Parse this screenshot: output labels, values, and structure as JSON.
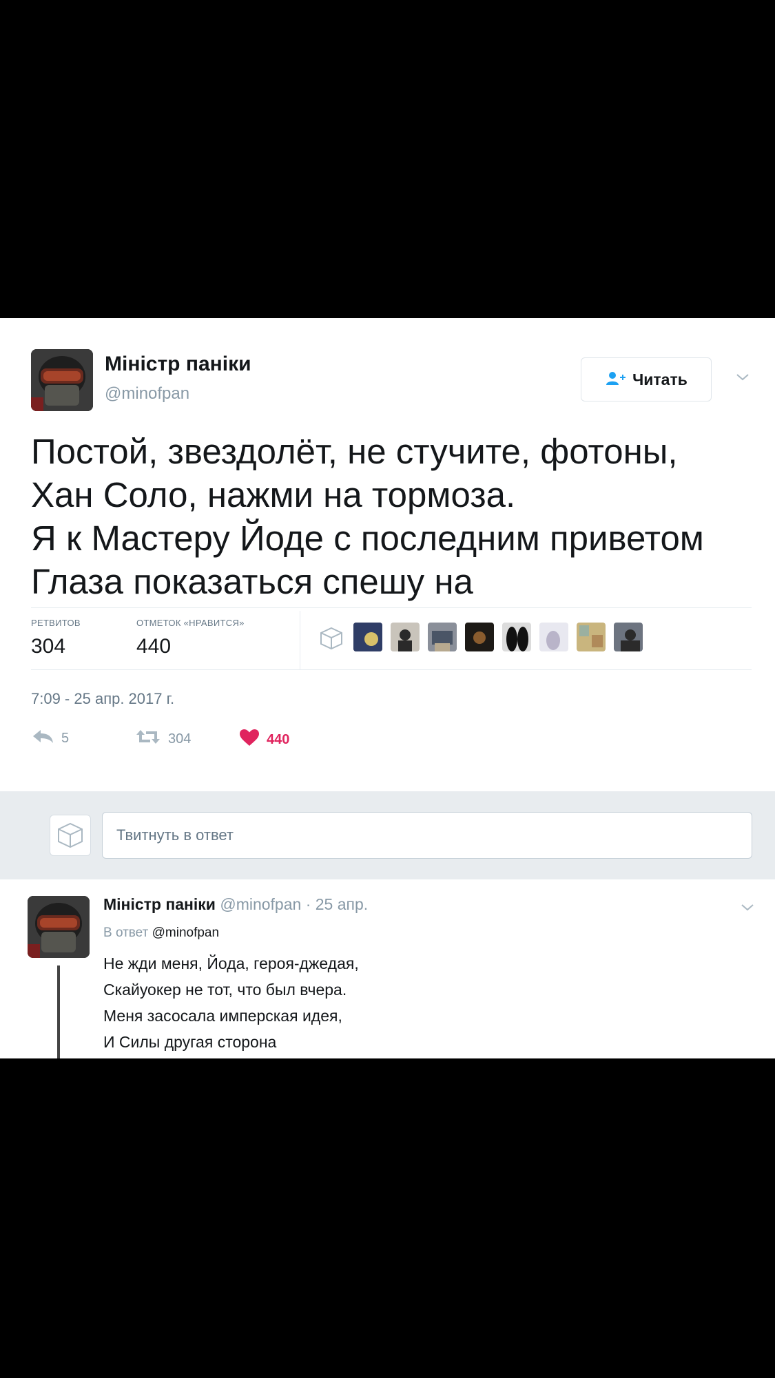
{
  "tweet": {
    "author_name": "Міністр паніки",
    "author_handle": "@minofpan",
    "follow_label": "Читать",
    "text_lines": [
      "Постой, звездолёт, не стучите, фотоны,",
      "Хан Соло, нажми на тормоза.",
      "Я к Мастеру Йоде с последним приветом",
      "Глаза показаться спешу на"
    ],
    "stats": {
      "retweets_label": "РЕТВИТОВ",
      "retweets_value": "304",
      "likes_label": "ОТМЕТОК «НРАВИТСЯ»",
      "likes_value": "440"
    },
    "timestamp": "7:09 - 25 апр. 2017 г.",
    "actions": {
      "reply_count": "5",
      "retweet_count": "304",
      "like_count": "440"
    }
  },
  "reply_composer": {
    "placeholder": "Твитнуть в ответ"
  },
  "reply_tweet": {
    "author_name": "Міністр паніки",
    "author_handle": "@minofpan",
    "separator": "·",
    "date": "25 апр.",
    "in_reply_prefix": "В ответ",
    "in_reply_handle": "@minofpan",
    "text_lines": [
      "Не жди меня, Йода, героя-джедая,",
      "Скайуокер не тот, что был вчера.",
      "Меня засосала имперская идея,",
      "И Силы другая сторона"
    ]
  },
  "colors": {
    "like_red": "#e0245e",
    "follow_blue": "#1da1f2",
    "muted_gray": "#657786"
  }
}
